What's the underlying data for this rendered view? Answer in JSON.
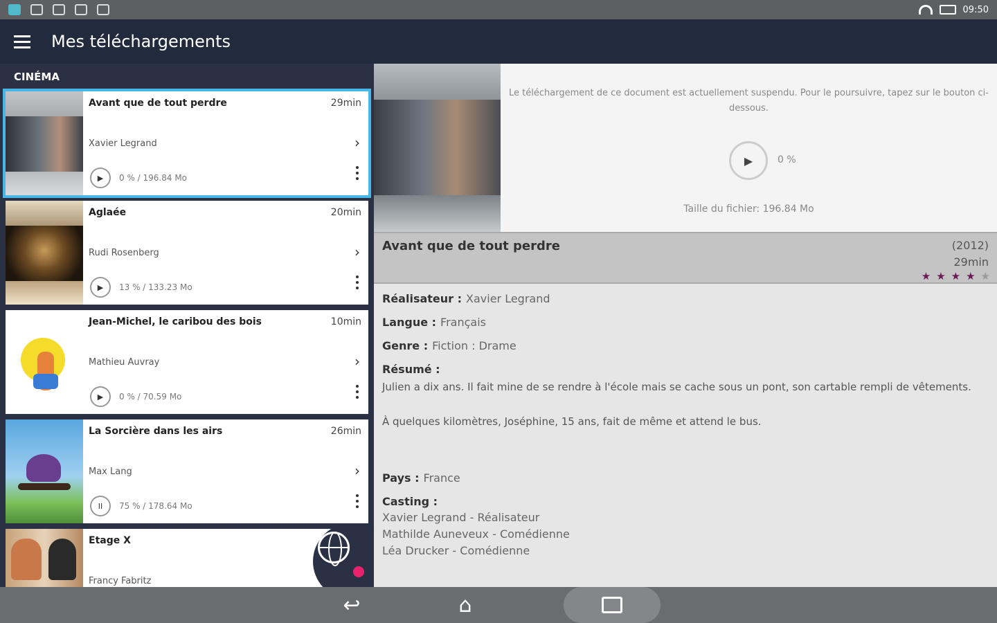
{
  "status_bar": {
    "time": "09:50"
  },
  "app": {
    "title": "Mes téléchargements"
  },
  "section": {
    "label": "CINÉMA"
  },
  "items": [
    {
      "title": "Avant que de tout perdre",
      "duration": "29min",
      "director": "Xavier Legrand",
      "progress": "0 % / 196.84 Mo",
      "state_icon": "play-icon",
      "selected": true
    },
    {
      "title": "Aglaée",
      "duration": "20min",
      "director": "Rudi Rosenberg",
      "progress": "13 % / 133.23 Mo",
      "state_icon": "play-icon",
      "selected": false
    },
    {
      "title": "Jean-Michel, le caribou des bois",
      "duration": "10min",
      "director": "Mathieu Auvray",
      "progress": "0 % / 70.59 Mo",
      "state_icon": "play-icon",
      "selected": false
    },
    {
      "title": "La Sorcière dans les airs",
      "duration": "26min",
      "director": "Max Lang",
      "progress": "75 % / 178.64 Mo",
      "state_icon": "pause-icon",
      "selected": false
    },
    {
      "title": "Etage X",
      "duration": "",
      "director": "Francy Fabritz",
      "progress": "",
      "state_icon": "",
      "selected": false
    }
  ],
  "detail": {
    "download_message": "Le téléchargement de ce document est actuellement suspendu. Pour le poursuivre, tapez sur le bouton ci-dessous.",
    "download_percent": "0 %",
    "file_size": "Taille du fichier: 196.84 Mo",
    "title": "Avant que de tout perdre",
    "year": "(2012)",
    "duration": "29min",
    "rating": 4,
    "rating_max": 5,
    "director_label": "Réalisateur :",
    "director": "Xavier Legrand",
    "language_label": "Langue :",
    "language": "Français",
    "genre_label": "Genre :",
    "genre": "Fiction : Drame",
    "summary_label": "Résumé :",
    "summary_p1": "Julien a dix ans. Il fait mine de se rendre à l'école mais se cache sous un pont, son cartable rempli de vêtements.",
    "summary_p2": "À quelques kilomètres, Joséphine, 15 ans, fait de même et attend le bus.",
    "country_label": "Pays :",
    "country": "France",
    "cast_label": "Casting :",
    "cast": [
      "Xavier Legrand - Réalisateur",
      "Mathilde Auneveux - Comédienne",
      "Léa Drucker - Comédienne"
    ]
  },
  "colors": {
    "accent": "#47b7e8",
    "star": "#6b1a55",
    "badge": "#e8236b",
    "appbar": "#222a3d"
  }
}
